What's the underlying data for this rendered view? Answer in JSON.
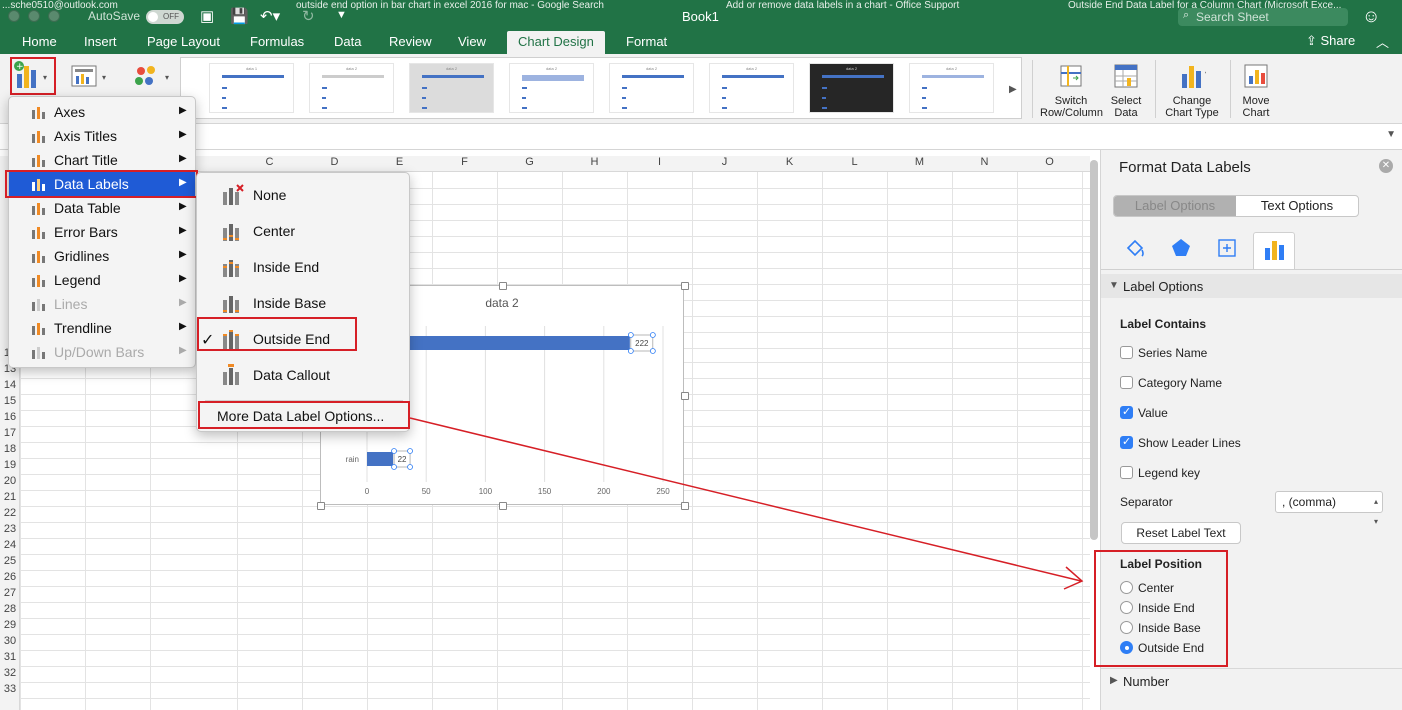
{
  "titlebar": {
    "autosave": "AutoSave",
    "toggle": "OFF",
    "title": "Book1",
    "bg_tab_1": "...sche0510@outlook.com",
    "bg_tab_2": "outside end option in bar chart in excel 2016 for mac - Google Search",
    "bg_tab_3": "Add or remove data labels in a chart - Office Support",
    "bg_tab_4": "Outside End Data Label for a Column Chart (Microsoft Exce...",
    "search_placeholder": "Search Sheet"
  },
  "tabs": {
    "home": "Home",
    "insert": "Insert",
    "page_layout": "Page Layout",
    "formulas": "Formulas",
    "data": "Data",
    "review": "Review",
    "view": "View",
    "chart_design": "Chart Design",
    "format": "Format",
    "share": "Share"
  },
  "ribbon": {
    "switch_label_1": "Switch",
    "switch_label_2": "Row/Column",
    "select_label_1": "Select",
    "select_label_2": "Data",
    "change_label_1": "Change",
    "change_label_2": "Chart Type",
    "move_label_1": "Move",
    "move_label_2": "Chart",
    "thumbs": [
      "data 1",
      "data 2",
      "data 2",
      "data 2",
      "data 2",
      "data 2",
      "data 2",
      "data 2"
    ]
  },
  "sheet": {
    "columns": [
      "C",
      "D",
      "E",
      "F",
      "G",
      "H",
      "I",
      "J",
      "K",
      "L",
      "M",
      "N",
      "O"
    ],
    "rows": [
      "12",
      "13",
      "14",
      "15",
      "16",
      "17",
      "18",
      "19",
      "20",
      "21",
      "22",
      "23",
      "24",
      "25",
      "26",
      "27",
      "28",
      "29",
      "30",
      "31",
      "32",
      "33"
    ]
  },
  "chart_data": {
    "type": "bar",
    "title": "data 2",
    "categories": [
      "",
      "rain"
    ],
    "values": [
      222,
      22
    ],
    "data_labels": [
      "222",
      "22"
    ],
    "xlim": [
      0,
      250
    ],
    "x_ticks": [
      "0",
      "50",
      "100",
      "150",
      "200",
      "250"
    ],
    "grid": true,
    "bar_color": "#4472c4"
  },
  "menu_chart_elements": {
    "items": [
      {
        "label": "Axes",
        "enabled": true
      },
      {
        "label": "Axis Titles",
        "enabled": true
      },
      {
        "label": "Chart Title",
        "enabled": true
      },
      {
        "label": "Data Labels",
        "enabled": true,
        "highlighted": true
      },
      {
        "label": "Data Table",
        "enabled": true
      },
      {
        "label": "Error Bars",
        "enabled": true
      },
      {
        "label": "Gridlines",
        "enabled": true
      },
      {
        "label": "Legend",
        "enabled": true
      },
      {
        "label": "Lines",
        "enabled": false
      },
      {
        "label": "Trendline",
        "enabled": true
      },
      {
        "label": "Up/Down Bars",
        "enabled": false
      }
    ]
  },
  "menu_data_labels": {
    "items": [
      {
        "label": "None"
      },
      {
        "label": "Center"
      },
      {
        "label": "Inside End"
      },
      {
        "label": "Inside Base"
      },
      {
        "label": "Outside End",
        "checked": true
      },
      {
        "label": "Data Callout"
      }
    ],
    "more": "More Data Label Options..."
  },
  "panel": {
    "title": "Format Data Labels",
    "tab_label_options": "Label Options",
    "tab_text_options": "Text Options",
    "section_label_options": "Label Options",
    "label_contains": "Label Contains",
    "checks": [
      {
        "label": "Series Name",
        "checked": false
      },
      {
        "label": "Category Name",
        "checked": false
      },
      {
        "label": "Value",
        "checked": true
      },
      {
        "label": "Show Leader Lines",
        "checked": true
      },
      {
        "label": "Legend key",
        "checked": false
      }
    ],
    "separator_label": "Separator",
    "separator_value": ", (comma)",
    "reset_button": "Reset Label Text",
    "label_position": "Label Position",
    "positions": [
      {
        "label": "Center",
        "selected": false
      },
      {
        "label": "Inside End",
        "selected": false
      },
      {
        "label": "Inside Base",
        "selected": false
      },
      {
        "label": "Outside End",
        "selected": true
      }
    ],
    "section_number": "Number"
  },
  "colors": {
    "excel_green": "#217346",
    "highlight_blue": "#1f5bd6",
    "annotation_red": "#d61f26",
    "check_blue": "#2f7ef5"
  }
}
